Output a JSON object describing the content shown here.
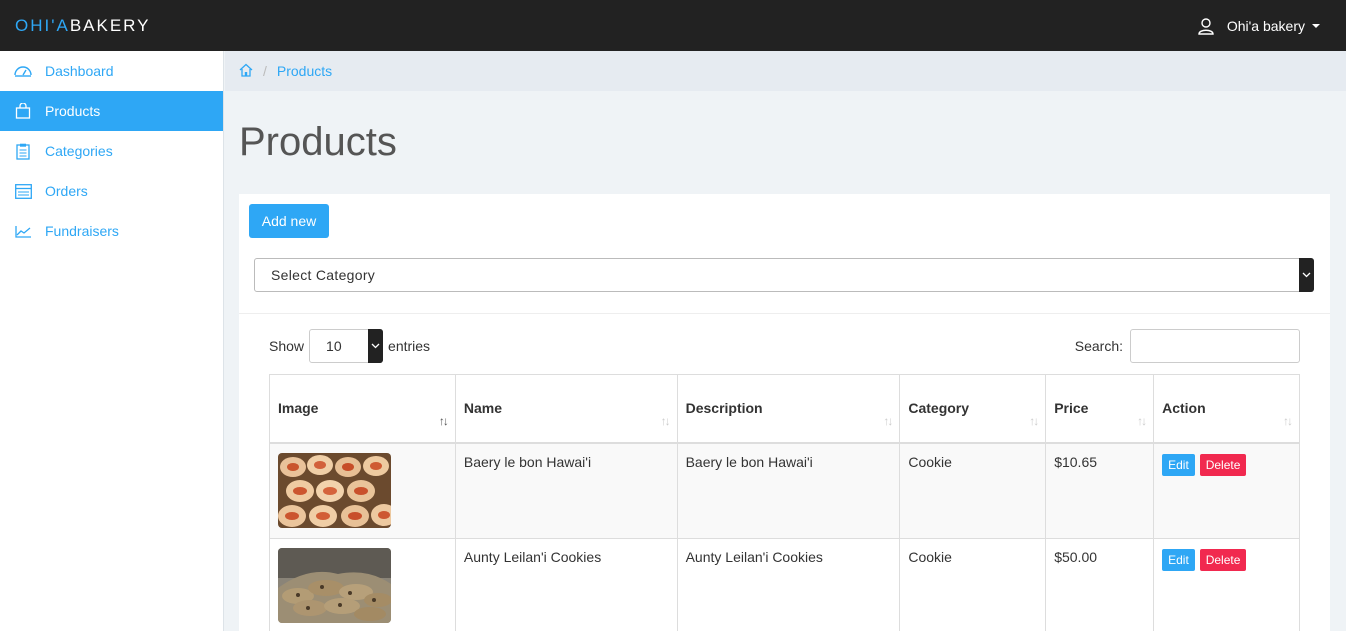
{
  "navbar": {
    "brand_accent": "OHI'A",
    "brand_rest": "BAKERY",
    "user_name": "Ohi'a bakery"
  },
  "sidebar": {
    "items": [
      {
        "label": "Dashboard",
        "icon": "dashboard-icon",
        "active": false
      },
      {
        "label": "Products",
        "icon": "bag-icon",
        "active": true
      },
      {
        "label": "Categories",
        "icon": "clipboard-icon",
        "active": false
      },
      {
        "label": "Orders",
        "icon": "list-icon",
        "active": false
      },
      {
        "label": "Fundraisers",
        "icon": "chart-icon",
        "active": false
      }
    ]
  },
  "breadcrumb": {
    "home_icon": "home-icon",
    "current": "Products"
  },
  "page": {
    "title": "Products",
    "add_button": "Add new",
    "category_select": "Select Category"
  },
  "datatable": {
    "show_label": "Show",
    "page_length": "10",
    "entries_label": "entries",
    "search_label": "Search:",
    "search_value": "",
    "columns": [
      "Image",
      "Name",
      "Description",
      "Category",
      "Price",
      "Action"
    ],
    "rows": [
      {
        "image": "cinnamon-rolls-photo",
        "name": "Baery le bon Hawai'i",
        "description": "Baery le bon Hawai'i",
        "category": "Cookie",
        "price": "$10.65"
      },
      {
        "image": "cookies-photo",
        "name": "Aunty Leilan'i Cookies",
        "description": "Aunty Leilan'i Cookies",
        "category": "Cookie",
        "price": "$50.00"
      }
    ],
    "edit_label": "Edit",
    "delete_label": "Delete"
  },
  "colors": {
    "accent": "#2ea7f5",
    "navbar": "#222222",
    "danger": "#f1294f"
  }
}
